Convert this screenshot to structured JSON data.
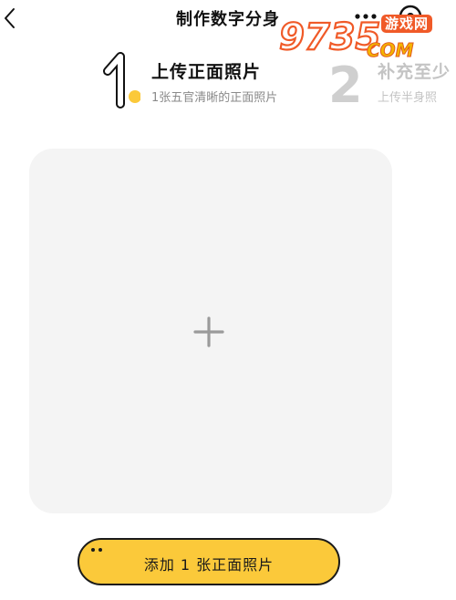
{
  "header": {
    "title": "制作数字分身",
    "back_icon": "chevron-left-icon",
    "more_icon": "more-dots-icon",
    "target_icon": "target-icon"
  },
  "watermark": {
    "logo_text": "9735",
    "suffix": "COM",
    "site_label": "游戏网"
  },
  "steps": [
    {
      "number": "1",
      "title": "上传正面照片",
      "subtitle": "1张五官清晰的正面照片",
      "state": "active"
    },
    {
      "number": "2",
      "title": "补充至少",
      "subtitle": "上传半身照",
      "state": "inactive"
    }
  ],
  "upload": {
    "icon": "plus-icon"
  },
  "action": {
    "button_label": "添加 1 张正面照片"
  },
  "colors": {
    "accent": "#fbc93a",
    "upload_bg": "#f4f4f4",
    "inactive_step": "#c4c4c4"
  }
}
